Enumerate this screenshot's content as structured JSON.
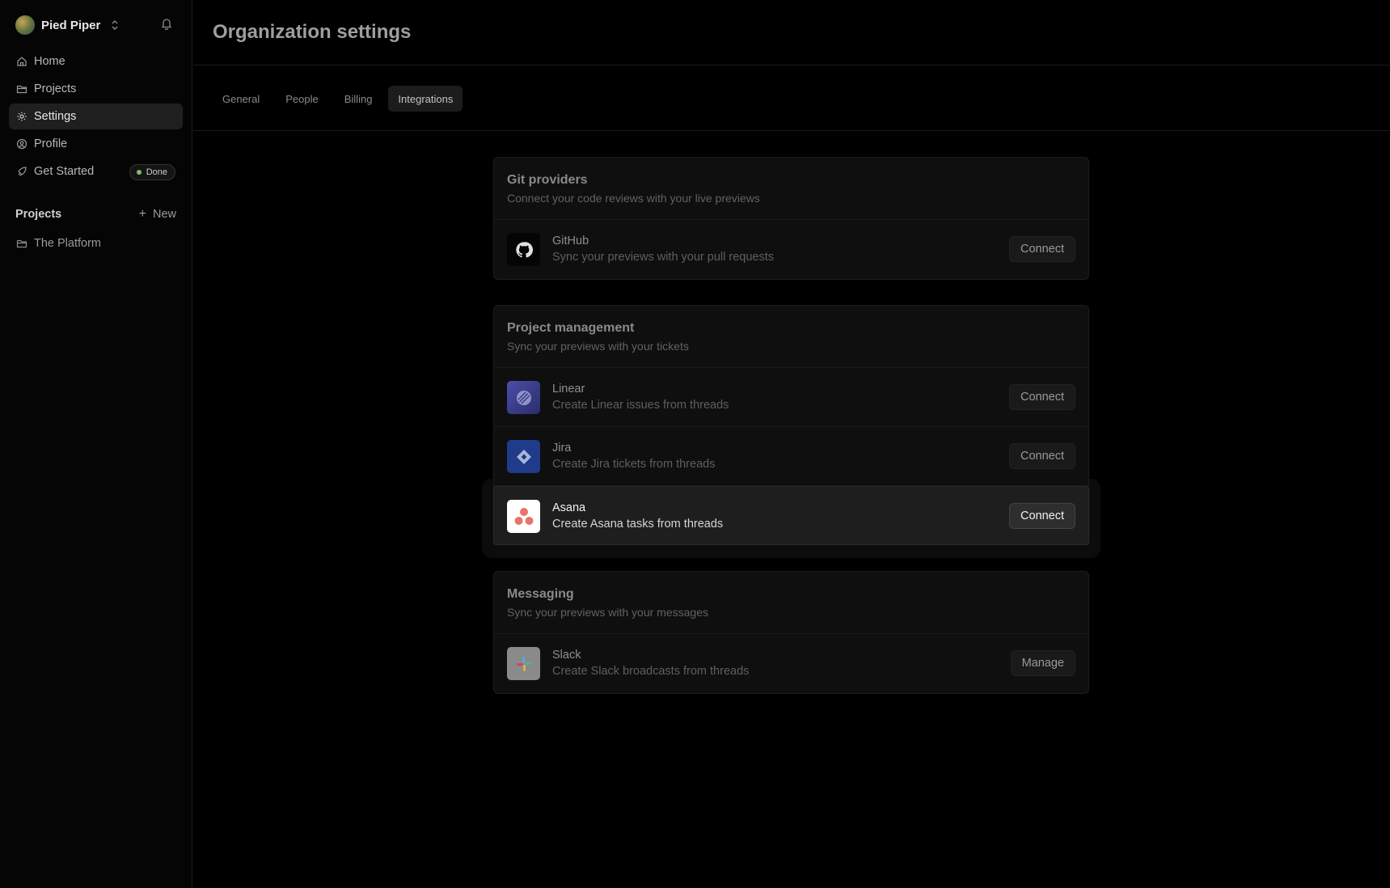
{
  "sidebar": {
    "org_name": "Pied Piper",
    "nav": [
      {
        "label": "Home",
        "icon": "home-icon"
      },
      {
        "label": "Projects",
        "icon": "folder-icon"
      },
      {
        "label": "Settings",
        "icon": "gear-icon",
        "active": true
      },
      {
        "label": "Profile",
        "icon": "user-circle-icon"
      },
      {
        "label": "Get Started",
        "icon": "rocket-icon",
        "badge": "Done"
      }
    ],
    "projects_title": "Projects",
    "new_label": "New",
    "projects": [
      {
        "label": "The Platform",
        "icon": "folder-icon"
      }
    ]
  },
  "header": {
    "title": "Organization settings"
  },
  "tabs": [
    {
      "label": "General"
    },
    {
      "label": "People"
    },
    {
      "label": "Billing"
    },
    {
      "label": "Integrations",
      "active": true
    }
  ],
  "sections": [
    {
      "title": "Git providers",
      "subtitle": "Connect your code reviews with your live previews",
      "items": [
        {
          "name": "GitHub",
          "desc": "Sync your previews with your pull requests",
          "action": "Connect"
        }
      ]
    },
    {
      "title": "Project management",
      "subtitle": "Sync your previews with your tickets",
      "items": [
        {
          "name": "Linear",
          "desc": "Create Linear issues from threads",
          "action": "Connect"
        },
        {
          "name": "Jira",
          "desc": "Create Jira tickets from threads",
          "action": "Connect"
        },
        {
          "name": "Asana",
          "desc": "Create Asana tasks from threads",
          "action": "Connect"
        }
      ]
    },
    {
      "title": "Messaging",
      "subtitle": "Sync your previews with your messages",
      "items": [
        {
          "name": "Slack",
          "desc": "Create Slack broadcasts from threads",
          "action": "Manage"
        }
      ]
    }
  ],
  "colors": {
    "background": "#000000",
    "card": "#0f0f0f",
    "done_dot": "#7fbf6a",
    "linear": "#3c3f8f",
    "jira": "#1f3b8a",
    "asana": "#e8736b"
  }
}
